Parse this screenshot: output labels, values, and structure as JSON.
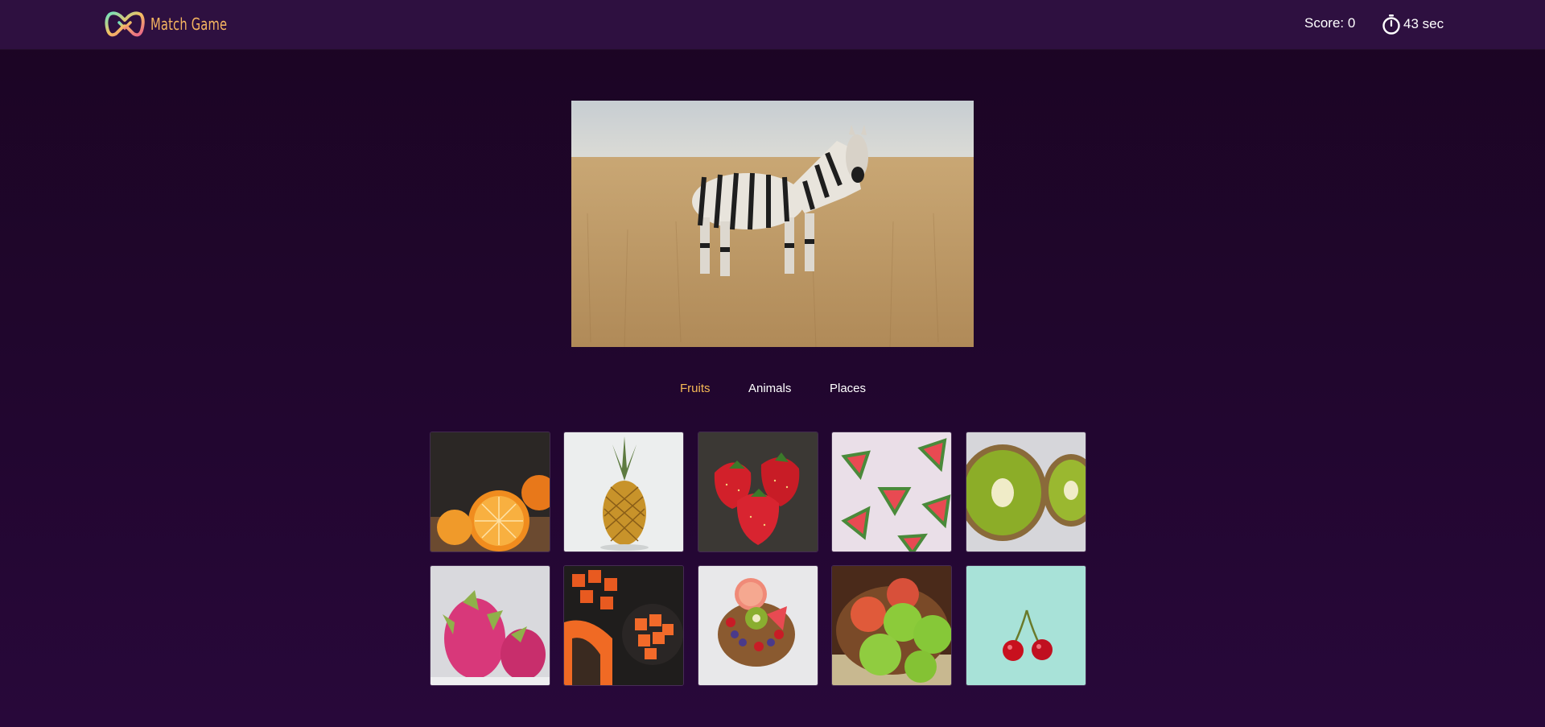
{
  "app": {
    "name": "Match Game",
    "brand_color": "#f5b560"
  },
  "header": {
    "score_label": "Score: 0",
    "timer_label": "43 sec",
    "timer_icon": "stopwatch-icon"
  },
  "hero": {
    "subject": "zebra",
    "icon": "zebra-photo"
  },
  "tabs": [
    {
      "label": "Fruits",
      "active": true
    },
    {
      "label": "Animals",
      "active": false
    },
    {
      "label": "Places",
      "active": false
    }
  ],
  "accent_color": "#f5b955",
  "cards": [
    {
      "subject": "orange"
    },
    {
      "subject": "pineapple"
    },
    {
      "subject": "strawberry"
    },
    {
      "subject": "watermelon"
    },
    {
      "subject": "kiwi"
    },
    {
      "subject": "dragon-fruit"
    },
    {
      "subject": "papaya"
    },
    {
      "subject": "fruit-bowl"
    },
    {
      "subject": "apple"
    },
    {
      "subject": "cherry"
    }
  ]
}
